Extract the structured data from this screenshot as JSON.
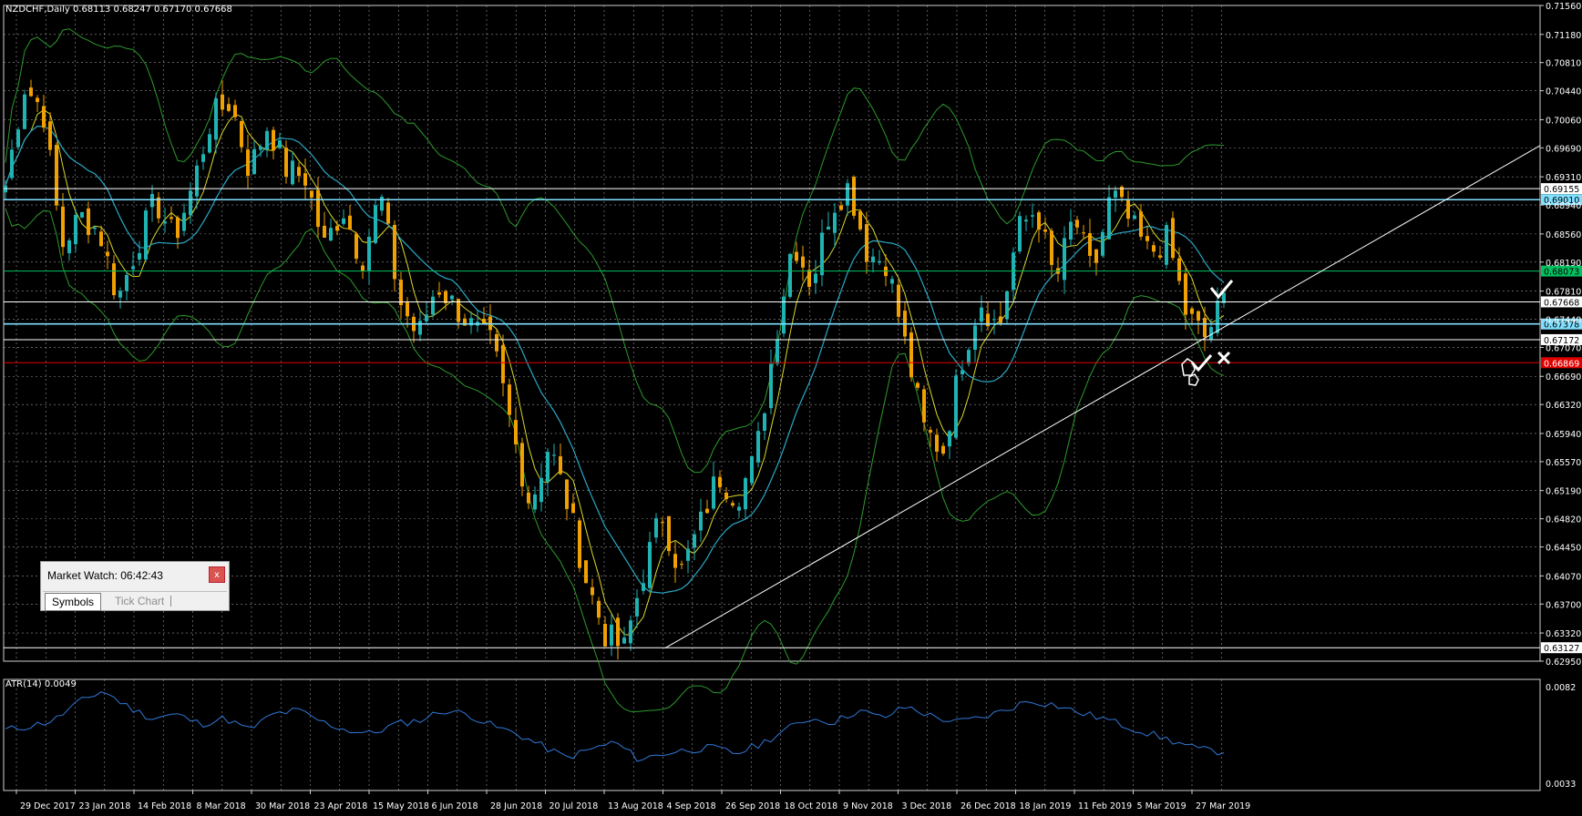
{
  "chart_header": "NZDCHF,Daily  0.68113 0.68247 0.67170 0.67668",
  "atr_header": "ATR(14) 0.0049",
  "colors": {
    "background": "#000000",
    "grid": "#c8c8c8",
    "candle_up": "#1fb3b3",
    "candle_down": "#f0a000",
    "ma_fast": "#d9d92a",
    "ma_slow": "#2aa8c8",
    "bollinger": "#2c9a2c",
    "atr_line": "#2f78d8",
    "trendline": "#ffffff",
    "level_green": "#00c060",
    "level_cyan": "#7fe0ff",
    "level_red": "#e00000"
  },
  "chart_data": {
    "type": "candlestick",
    "symbol": "NZDCHF",
    "timeframe": "Daily",
    "ylim": [
      0.6295,
      0.7156
    ],
    "price_ticks": [
      "0.71560",
      "0.71180",
      "0.70810",
      "0.70440",
      "0.70060",
      "0.69690",
      "0.69310",
      "0.68940",
      "0.68560",
      "0.68190",
      "0.67810",
      "0.67440",
      "0.67070",
      "0.66690",
      "0.66320",
      "0.65940",
      "0.65570",
      "0.65190",
      "0.64820",
      "0.64450",
      "0.64070",
      "0.63700",
      "0.63320",
      "0.62950"
    ],
    "date_labels": [
      "29 Dec 2017",
      "23 Jan 2018",
      "14 Feb 2018",
      "8 Mar 2018",
      "30 Mar 2018",
      "23 Apr 2018",
      "15 May 2018",
      "6 Jun 2018",
      "28 Jun 2018",
      "20 Jul 2018",
      "13 Aug 2018",
      "4 Sep 2018",
      "26 Sep 2018",
      "18 Oct 2018",
      "9 Nov 2018",
      "3 Dec 2018",
      "26 Dec 2018",
      "18 Jan 2019",
      "11 Feb 2019",
      "5 Mar 2019",
      "27 Mar 2019"
    ],
    "price_anchors": [
      0.692,
      0.705,
      0.702,
      0.684,
      0.688,
      0.686,
      0.677,
      0.684,
      0.69,
      0.685,
      0.692,
      0.701,
      0.703,
      0.694,
      0.7,
      0.694,
      0.693,
      0.684,
      0.689,
      0.682,
      0.691,
      0.677,
      0.672,
      0.679,
      0.676,
      0.673,
      0.671,
      0.66,
      0.65,
      0.658,
      0.65,
      0.64,
      0.633,
      0.631,
      0.641,
      0.649,
      0.641,
      0.647,
      0.654,
      0.651,
      0.656,
      0.671,
      0.685,
      0.679,
      0.689,
      0.692,
      0.683,
      0.682,
      0.671,
      0.66,
      0.657,
      0.669,
      0.677,
      0.673,
      0.686,
      0.689,
      0.679,
      0.688,
      0.68,
      0.691,
      0.687,
      0.683,
      0.685,
      0.675,
      0.672,
      0.677
    ],
    "levels": [
      {
        "price": 0.69155,
        "label": "0.69155",
        "kind": "white"
      },
      {
        "price": 0.6901,
        "label": "0.69010",
        "kind": "cyan"
      },
      {
        "price": 0.68073,
        "label": "0.68073",
        "kind": "green"
      },
      {
        "price": 0.67668,
        "label": "0.67668",
        "kind": "white"
      },
      {
        "price": 0.67378,
        "label": "0.67378",
        "kind": "cyan"
      },
      {
        "price": 0.67172,
        "label": "0.67172",
        "kind": "white"
      },
      {
        "price": 0.66869,
        "label": "0.66869",
        "kind": "red"
      },
      {
        "price": 0.63127,
        "label": "0.63127",
        "kind": "white"
      }
    ],
    "trendline": {
      "from": {
        "date_label": "4 Sep 2018",
        "price": 0.6312
      },
      "to": {
        "date_label": "beyond 27 Mar 2019",
        "price": 0.6972
      }
    },
    "atr": {
      "ticks": [
        "0.0082",
        "0.0033"
      ],
      "ylim": [
        0.0033,
        0.0082
      ],
      "values": [
        0.006,
        0.0062,
        0.0065,
        0.0074,
        0.008,
        0.0072,
        0.0066,
        0.0068,
        0.0063,
        0.0066,
        0.006,
        0.0068,
        0.007,
        0.0064,
        0.006,
        0.0058,
        0.0063,
        0.0065,
        0.007,
        0.0068,
        0.0062,
        0.0058,
        0.0052,
        0.0046,
        0.005,
        0.0054,
        0.0045,
        0.0048,
        0.005,
        0.0051,
        0.0048,
        0.0053,
        0.006,
        0.0066,
        0.0064,
        0.007,
        0.0066,
        0.0072,
        0.0067,
        0.0064,
        0.0066,
        0.007,
        0.0075,
        0.0073,
        0.0069,
        0.0066,
        0.0062,
        0.0058,
        0.0054,
        0.005,
        0.0049
      ]
    }
  },
  "market_watch": {
    "title": "Market Watch: 06:42:43",
    "close_label": "x",
    "tabs": [
      "Symbols",
      "Tick Chart"
    ]
  }
}
